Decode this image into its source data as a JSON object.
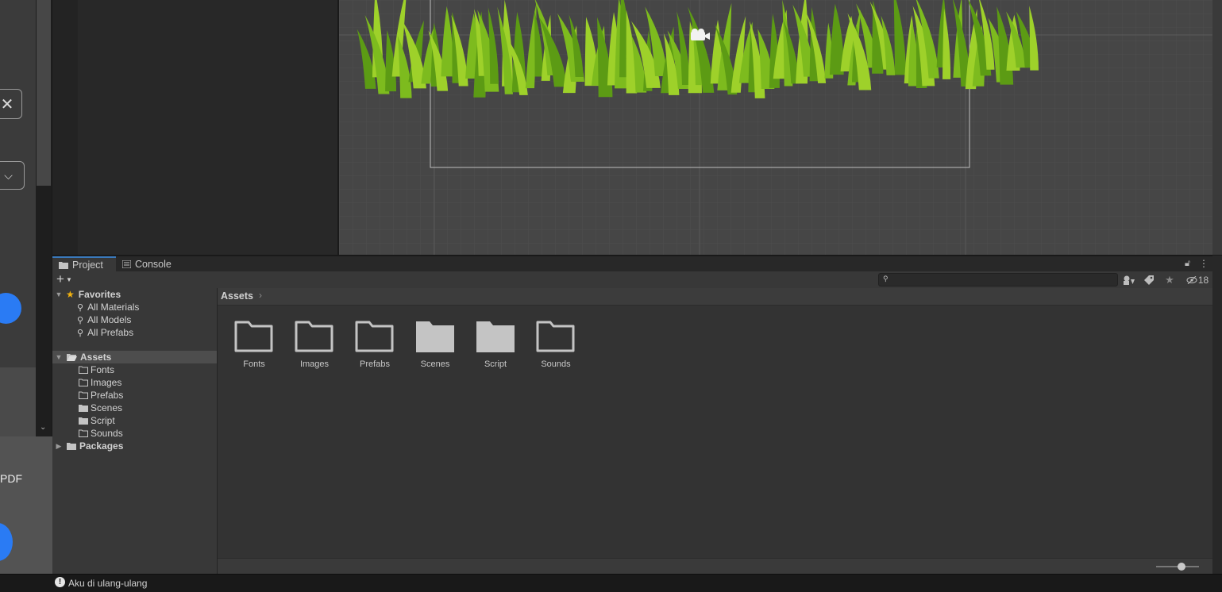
{
  "external": {
    "pdf_label": "PDF"
  },
  "tabs": [
    {
      "label": "Project",
      "icon": "folder-icon"
    },
    {
      "label": "Console",
      "icon": "console-icon"
    }
  ],
  "toolbar": {
    "add_label": "+",
    "hidden_count": "18"
  },
  "tree": {
    "favorites": {
      "label": "Favorites",
      "items": [
        "All Materials",
        "All Models",
        "All Prefabs"
      ]
    },
    "assets": {
      "label": "Assets",
      "items": [
        "Fonts",
        "Images",
        "Prefabs",
        "Scenes",
        "Script",
        "Sounds"
      ]
    },
    "packages": {
      "label": "Packages"
    }
  },
  "breadcrumb": {
    "label": "Assets"
  },
  "grid_items": [
    {
      "label": "Fonts",
      "filled": false
    },
    {
      "label": "Images",
      "filled": false
    },
    {
      "label": "Prefabs",
      "filled": false
    },
    {
      "label": "Scenes",
      "filled": true
    },
    {
      "label": "Script",
      "filled": true
    },
    {
      "label": "Sounds",
      "filled": false
    }
  ],
  "status": {
    "message": "Aku di ulang-ulang"
  },
  "colors": {
    "accent": "#3a79bb",
    "grass_light": "#9ed12a",
    "grass_dark": "#5c9b14",
    "external_blue": "#2a7bf4"
  }
}
